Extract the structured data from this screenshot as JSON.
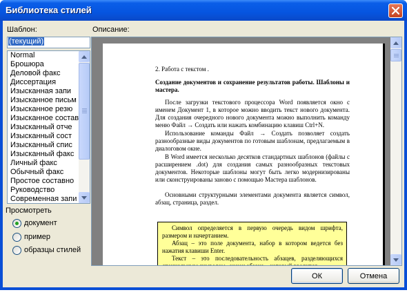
{
  "window": {
    "title": "Библиотека стилей"
  },
  "template": {
    "label": "Шаблон:",
    "current_value": "(текущий)",
    "items": [
      "Normal",
      "Брошюра",
      "Деловой факс",
      "Диссертация",
      "Изысканная запи",
      "Изысканное письм",
      "Изысканное резю",
      "Изысканное состав",
      "Изысканный отче",
      "Изысканный сост",
      "Изысканный спис",
      "Изысканный факс",
      "Личный факс",
      "Обычный факс",
      "Простое составно",
      "Руководство",
      "Современная запи"
    ]
  },
  "preview_group": {
    "label": "Просмотреть",
    "options": [
      "документ",
      "пример",
      "образцы стилей"
    ],
    "selected": "документ"
  },
  "description": {
    "label": "Описание:",
    "heading": "2. Работа с текстом .",
    "subheading": "Создание документов и сохранение результатов работы. Шаблоны и мастера.",
    "p1": "После загрузки текстового процессора Word появляется окно с именем Документ 1, в которое можно вводить текст нового документа. Для создания очередного нового документа можно выполнить команду меню Файл → Создать или нажать комбинацию клавиш Ctrl+N.",
    "p2": "Использование команды Файл → Создать позволяет создать разнообразные виды документов по готовым шаблонам, предлагаемым в диалоговом окне.",
    "p3": "В Word имеется несколько десятков стандартных шаблонов (файлы с расширением .dot) для создания самых разнообразных текстовых документов. Некоторые шаблоны могут быть легко модернизированы или сконструированы заново с помощью Мастера шаблонов.",
    "p4": "Основными структурными элементами документа является символ, абзац, страница, раздел.",
    "box1": "Символ определяется в первую очередь видом шрифта, размером и начертанием.",
    "box2": "Абзац – это поле документа, набор в котором ведется без нажатия клавиши Enter.",
    "box3": "Текст – это последовательность абзацев, разделяющихся специальным символом «конец абзаца», который вводится"
  },
  "buttons": {
    "ok": "ОК",
    "cancel": "Отмена"
  }
}
